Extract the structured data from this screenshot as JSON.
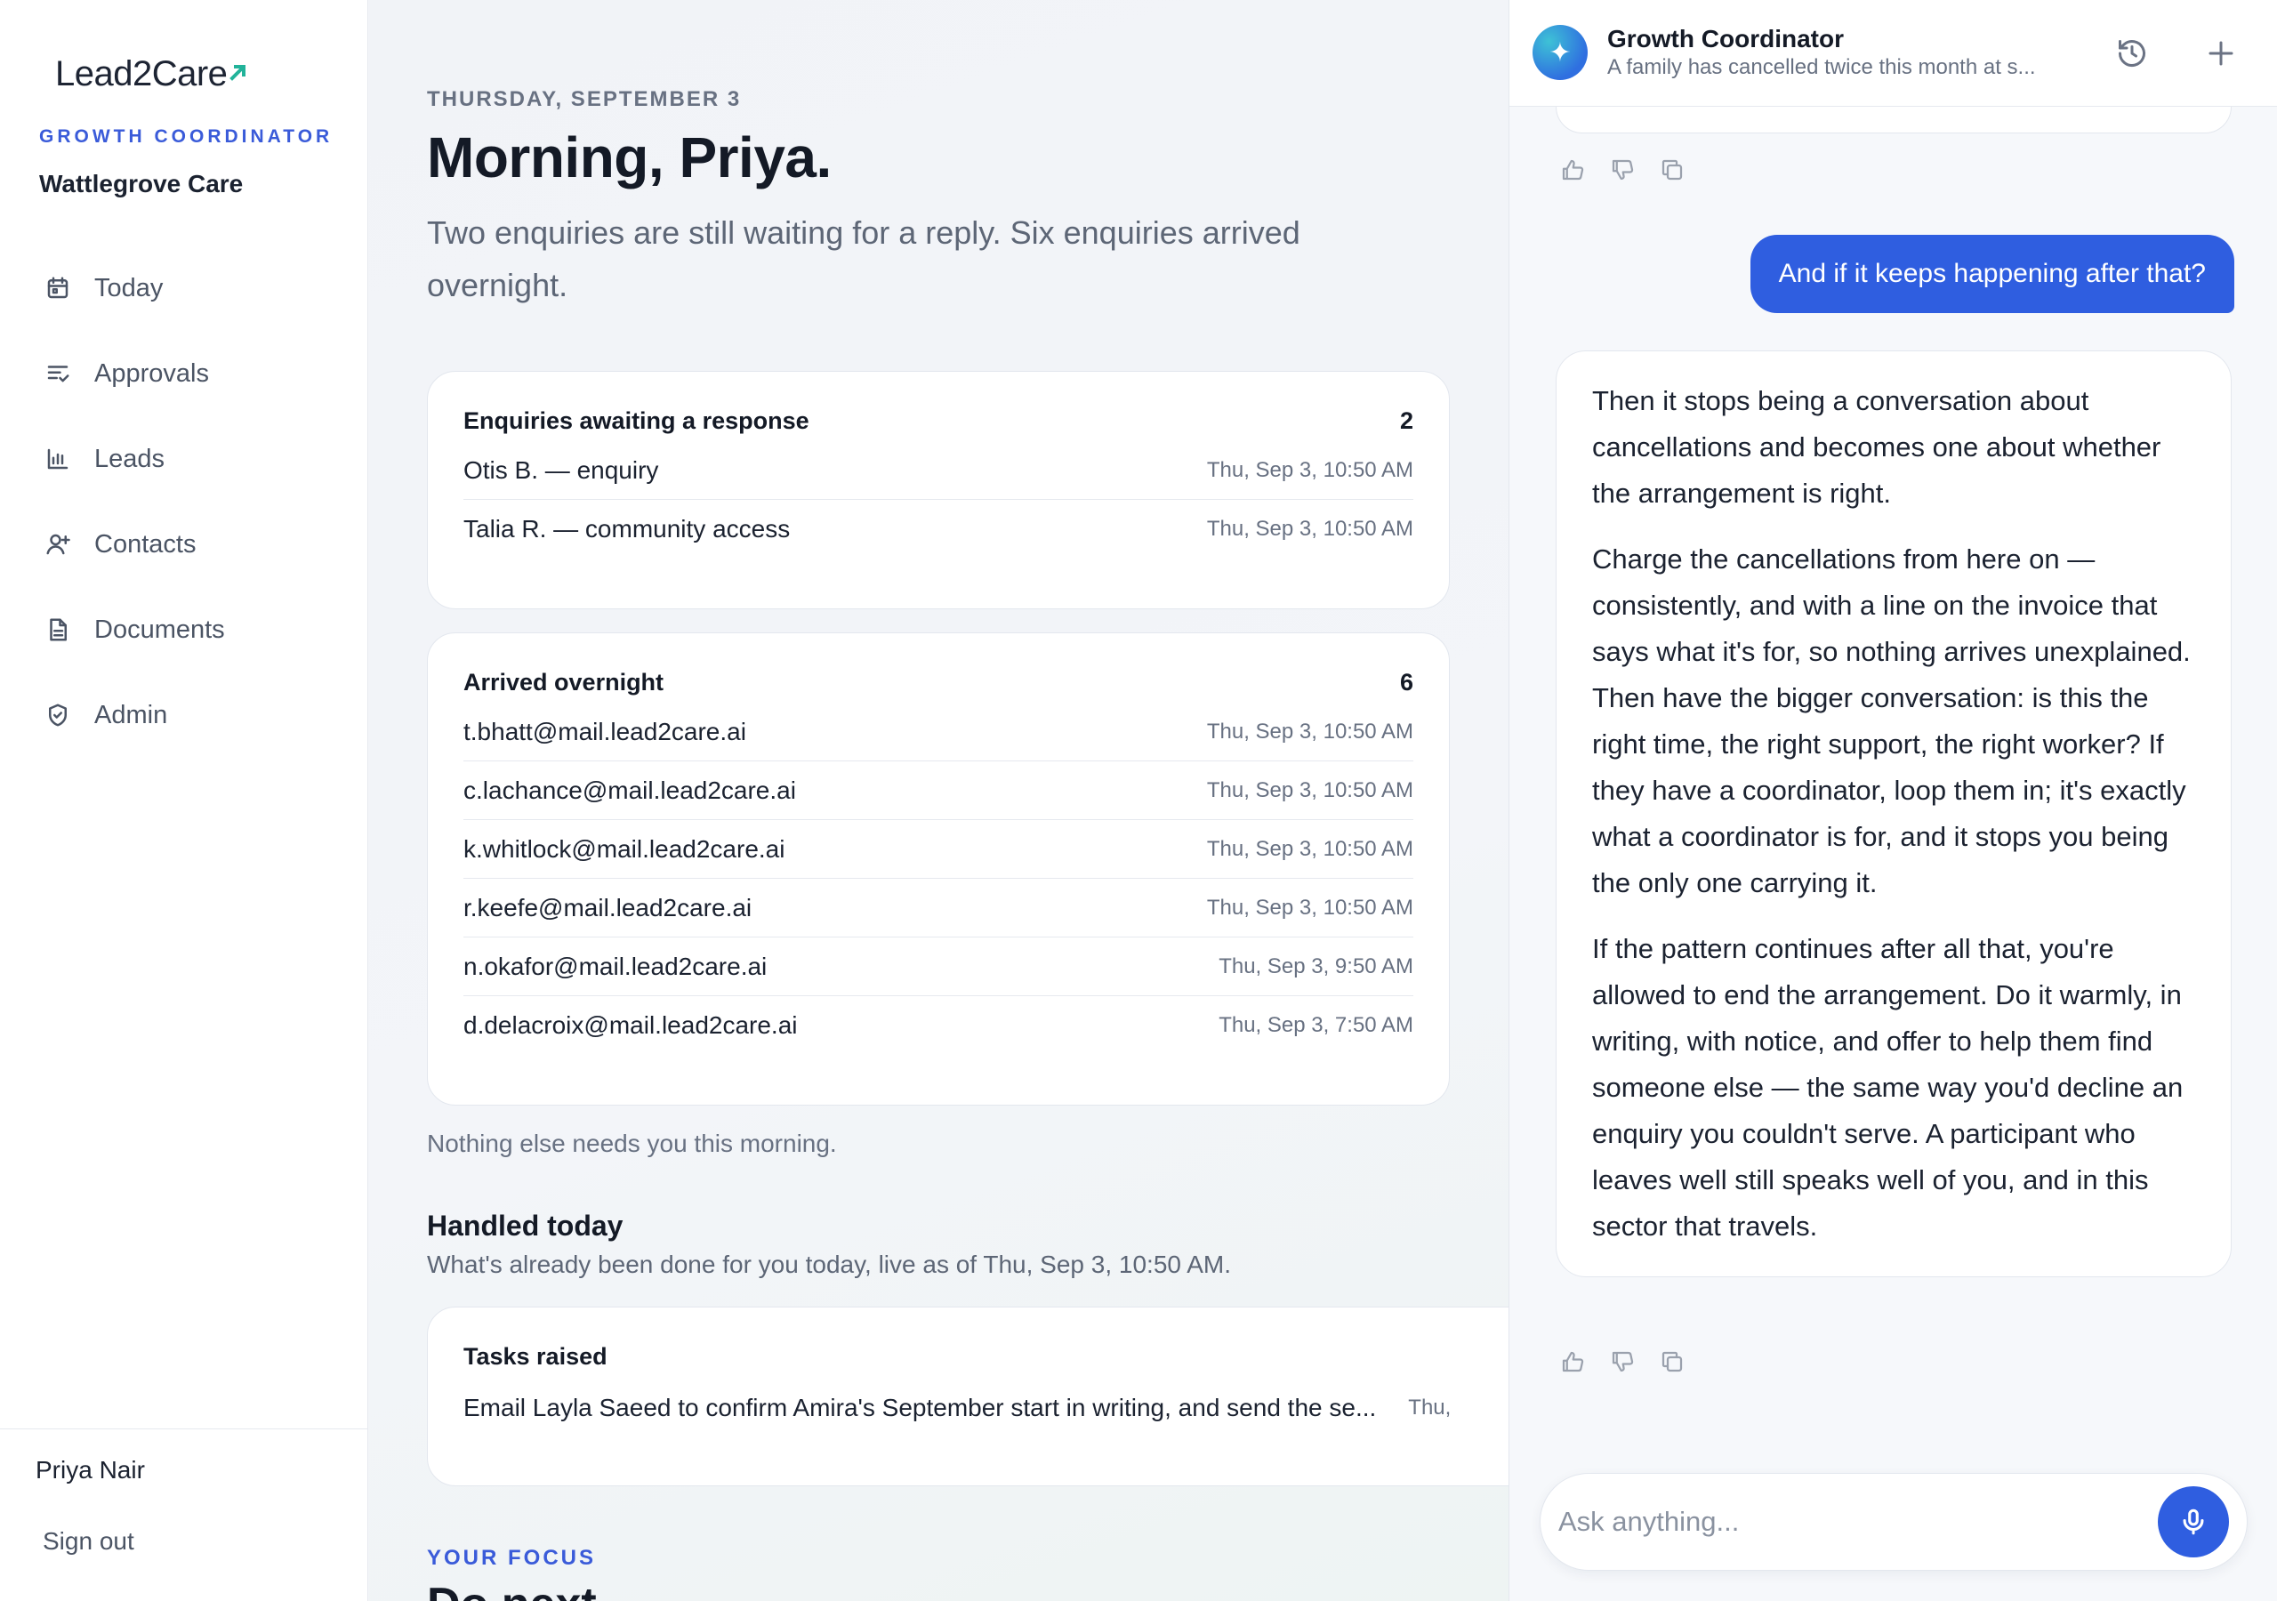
{
  "brand": {
    "logo_text": "Lead2Care",
    "role": "GROWTH COORDINATOR",
    "org": "Wattlegrove Care",
    "accent": "#3a5bd9",
    "logo_mark_color": "#22b39a"
  },
  "nav": {
    "items": [
      {
        "label": "Today",
        "icon": "calendar-icon"
      },
      {
        "label": "Approvals",
        "icon": "list-check-icon"
      },
      {
        "label": "Leads",
        "icon": "bar-chart-icon"
      },
      {
        "label": "Contacts",
        "icon": "user-plus-icon"
      },
      {
        "label": "Documents",
        "icon": "document-icon"
      },
      {
        "label": "Admin",
        "icon": "shield-icon"
      }
    ]
  },
  "user": {
    "name": "Priya Nair",
    "sign_out": "Sign out"
  },
  "main": {
    "date": "THURSDAY, SEPTEMBER 3",
    "greeting": "Morning, Priya.",
    "summary": "Two enquiries are still waiting for a reply. Six enquiries arrived overnight.",
    "awaiting": {
      "title": "Enquiries awaiting a response",
      "count": "2",
      "rows": [
        {
          "label": "Otis B. — enquiry",
          "time": "Thu, Sep 3, 10:50 AM"
        },
        {
          "label": "Talia R. — community access",
          "time": "Thu, Sep 3, 10:50 AM"
        }
      ]
    },
    "overnight": {
      "title": "Arrived overnight",
      "count": "6",
      "rows": [
        {
          "label": "t.bhatt@mail.lead2care.ai",
          "time": "Thu, Sep 3, 10:50 AM"
        },
        {
          "label": "c.lachance@mail.lead2care.ai",
          "time": "Thu, Sep 3, 10:50 AM"
        },
        {
          "label": "k.whitlock@mail.lead2care.ai",
          "time": "Thu, Sep 3, 10:50 AM"
        },
        {
          "label": "r.keefe@mail.lead2care.ai",
          "time": "Thu, Sep 3, 10:50 AM"
        },
        {
          "label": "n.okafor@mail.lead2care.ai",
          "time": "Thu, Sep 3, 9:50 AM"
        },
        {
          "label": "d.delacroix@mail.lead2care.ai",
          "time": "Thu, Sep 3, 7:50 AM"
        }
      ]
    },
    "nothing_else": "Nothing else needs you this morning.",
    "handled": {
      "title": "Handled today",
      "subtitle": "What's already been done for you today, live as of Thu, Sep 3, 10:50 AM.",
      "tasks_title": "Tasks raised",
      "task_label": "Email Layla Saeed to confirm Amira's September start in writing, and send the se...",
      "task_time": "Thu,"
    },
    "focus_kicker": "YOUR FOCUS",
    "do_next": "Do next"
  },
  "chat": {
    "title": "Growth Coordinator",
    "subtitle": "A family has cancelled twice this month at s...",
    "user_message": "And if it keeps happening after that?",
    "ai_paragraphs": [
      "Then it stops being a conversation about cancellations and becomes one about whether the arrangement is right.",
      "Charge the cancellations from here on — consistently, and with a line on the invoice that says what it's for, so nothing arrives unexplained. Then have the bigger conversation: is this the right time, the right support, the right worker? If they have a coordinator, loop them in; it's exactly what a coordinator is for, and it stops you being the only one carrying it.",
      "If the pattern continues after all that, you're allowed to end the arrangement. Do it warmly, in writing, with notice, and offer to help them find someone else — the same way you'd decline an enquiry you couldn't serve. A participant who leaves well still speaks well of you, and in this sector that travels."
    ],
    "input_placeholder": "Ask anything...",
    "user_bubble_color": "#2f5ee0"
  }
}
